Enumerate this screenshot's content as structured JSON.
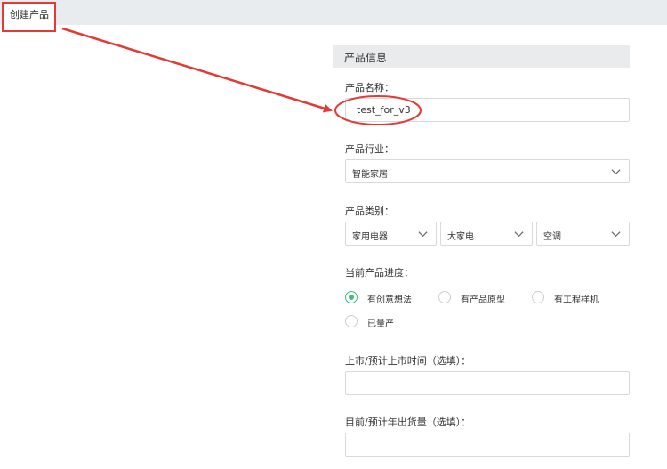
{
  "tab": {
    "label": "创建产品"
  },
  "section": {
    "title": "产品信息"
  },
  "fields": {
    "name": {
      "label": "产品名称：",
      "value": "test_for_v3"
    },
    "industry": {
      "label": "产品行业：",
      "value": "智能家居"
    },
    "category": {
      "label": "产品类别：",
      "level1": "家用电器",
      "level2": "大家电",
      "level3": "空调"
    },
    "progress": {
      "label": "当前产品进度：",
      "options": [
        "有创意想法",
        "有产品原型",
        "有工程样机",
        "已量产"
      ],
      "selected": "有创意想法"
    },
    "launch_time": {
      "label": "上市/预计上市时间（选填）：",
      "value": ""
    },
    "annual_volume": {
      "label": "目前/预计年出货量（选填）：",
      "value": ""
    }
  },
  "colors": {
    "annotation": "#e53935",
    "radio_checked": "#3ec07a"
  },
  "icons": {
    "select_arrow": "chevron-down-icon"
  }
}
